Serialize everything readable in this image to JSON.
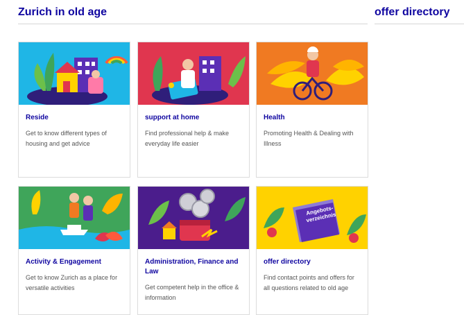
{
  "header": {
    "title": "Zurich in old age",
    "aside_title": "offer directory"
  },
  "cards": [
    {
      "title": "Reside",
      "description": "Get to know different types of housing and get advice",
      "art_color": "#1fb6e6",
      "art_icon": "houses-illustration-icon"
    },
    {
      "title": "support at home",
      "description": "Find professional help & make everyday life easier",
      "art_color": "#e0364f",
      "art_icon": "home-care-illustration-icon"
    },
    {
      "title": "Health",
      "description": "Promoting Health & Dealing with Illness",
      "art_color": "#f07a22",
      "art_icon": "cyclist-illustration-icon"
    },
    {
      "title": "Activity & Engagement",
      "description": "Get to know Zurich as a place for versatile activities",
      "art_color": "#3fa55a",
      "art_icon": "hikers-illustration-icon"
    },
    {
      "title": "Administration, Finance and Law",
      "description": "Get competent help in the office & information",
      "art_color": "#4b1d8c",
      "art_icon": "coins-illustration-icon"
    },
    {
      "title": "offer directory",
      "description": "Find contact points and offers for all questions related to old age",
      "art_color": "#ffd200",
      "art_icon": "folder-illustration-icon",
      "art_label": "Angebots-verzeichnis"
    }
  ],
  "colors": {
    "heading": "#0f05a0",
    "text": "#555555",
    "border": "#dcdcdc"
  }
}
